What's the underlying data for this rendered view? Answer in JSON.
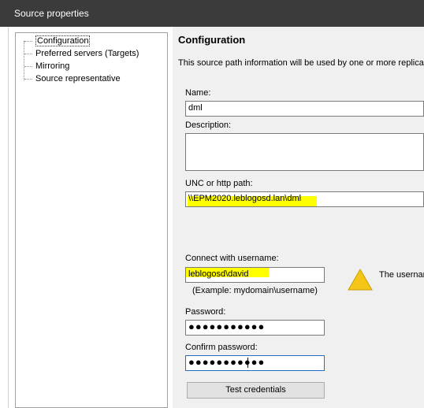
{
  "window": {
    "title": "Source properties"
  },
  "tree": {
    "items": [
      {
        "label": "Configuration",
        "selected": true
      },
      {
        "label": "Preferred servers (Targets)"
      },
      {
        "label": "Mirroring"
      },
      {
        "label": "Source representative"
      }
    ]
  },
  "panel": {
    "heading": "Configuration",
    "info": "This source path information will be used by one or more replica",
    "name_label": "Name:",
    "name_value": "dml",
    "description_label": "Description:",
    "description_value": "",
    "unc_label": "UNC or http path:",
    "unc_value": "\\\\EPM2020.leblogosd.lan\\dml",
    "connect_label": "Connect  with username:",
    "username_value": "leblogosd\\david",
    "example_text": "(Example: mydomain\\username)",
    "password_label": "Password:",
    "password_value": "●●●●●●●●●●●",
    "confirm_label": "Confirm password:",
    "confirm_value": "●●●●●●●●●●●",
    "test_button": "Test credentials",
    "warning_text": "The usernar"
  },
  "colors": {
    "titlebar": "#3b3b3b",
    "highlight": "#ffff00",
    "warning": "#f5c518",
    "focus": "#1e70c8"
  }
}
